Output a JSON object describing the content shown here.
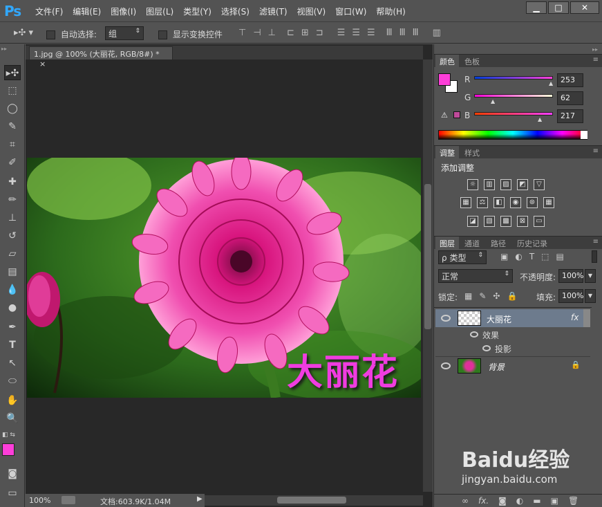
{
  "app": {
    "logo": "Ps"
  },
  "menu": [
    "文件(F)",
    "编辑(E)",
    "图像(I)",
    "图层(L)",
    "类型(Y)",
    "选择(S)",
    "滤镜(T)",
    "视图(V)",
    "窗口(W)",
    "帮助(H)"
  ],
  "window_buttons": {
    "minimize": "▁",
    "maximize": "□",
    "close": "✕"
  },
  "options": {
    "auto_select_label": "自动选择:",
    "auto_select_value": "组",
    "show_transform_label": "显示变换控件"
  },
  "document": {
    "tab_title": "1.jpg @ 100% (大丽花, RGB/8#) *",
    "tab_close": "×",
    "canvas_text": "大丽花",
    "text_color": "#f03ce0"
  },
  "status": {
    "zoom": "100%",
    "doc_info": "文档:603.9K/1.04M"
  },
  "color_panel": {
    "tabs": [
      "颜色",
      "色板"
    ],
    "channels": [
      {
        "label": "R",
        "value": "253"
      },
      {
        "label": "G",
        "value": "62"
      },
      {
        "label": "B",
        "value": "217"
      }
    ],
    "foreground": "#fd3ed9",
    "background": "#ffffff"
  },
  "adjust_panel": {
    "tabs": [
      "调整",
      "样式"
    ],
    "title": "添加调整"
  },
  "layers_panel": {
    "tabs": [
      "图层",
      "通道",
      "路径",
      "历史记录"
    ],
    "filter_label": "类型",
    "blend_mode": "正常",
    "opacity_label": "不透明度:",
    "opacity_value": "100%",
    "lock_label": "锁定:",
    "fill_label": "填充:",
    "fill_value": "100%",
    "layers": [
      {
        "name": "大丽花",
        "fx": "fx",
        "selected": true
      },
      {
        "name": "效果",
        "sub": true
      },
      {
        "name": "投影",
        "sub2": true
      },
      {
        "name": "背景",
        "locked": true
      }
    ],
    "footer_fx": "fx."
  },
  "watermark": {
    "brand": "Baidu经验",
    "url": "jingyan.baidu.com"
  }
}
